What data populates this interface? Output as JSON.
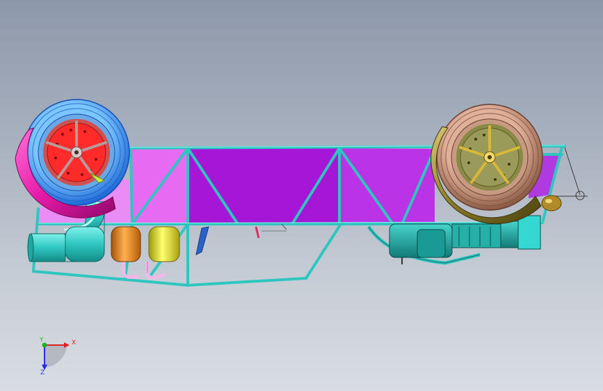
{
  "viewport": {
    "background_top": "#8d98aa",
    "background_bottom": "#d9dde3"
  },
  "model": {
    "frame_color": "#2fc6c0",
    "panel_light": "#e66bf2",
    "panel_dark": "#a516d6",
    "panel_mid": "#bb33e6",
    "left_wheel_tire": "#2f8ff0",
    "left_wheel_fender": "#e61aa8",
    "left_brake_disc": "#ff2a2a",
    "right_wheel_tire": "#b07f68",
    "right_wheel_fender": "#8a7a28",
    "right_brake_disc": "#9a9a5a",
    "tank_orange": "#f08a1a",
    "tank_yellow": "#e8e020",
    "exhaust_cyan": "#34d8d0",
    "pipe_pink": "#f2b8e8"
  },
  "triad": {
    "x_label": "X",
    "y_label": "Y",
    "z_label": "Z",
    "x_color": "#e02020",
    "y_color": "#20b020",
    "z_color": "#2030e0"
  }
}
